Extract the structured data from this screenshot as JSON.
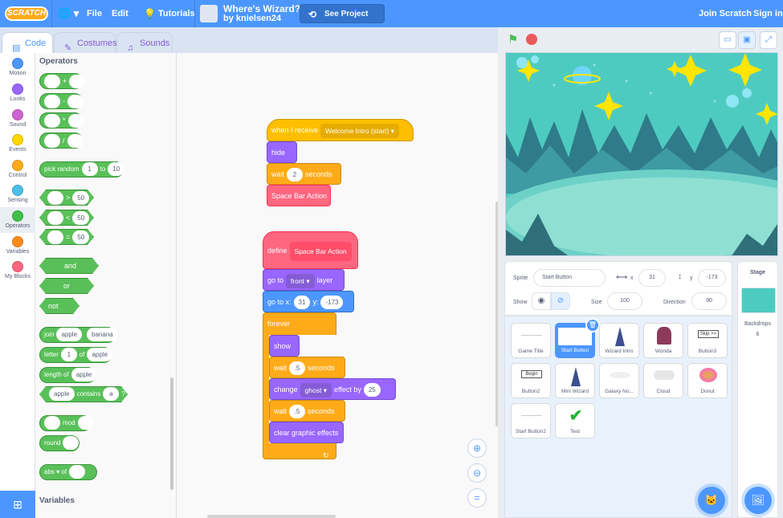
{
  "menu": {
    "logo": "SCRATCH",
    "file": "File",
    "edit": "Edit",
    "tutorials": "Tutorials",
    "project_title": "Where's Wizard?",
    "project_author": "by knielsen24",
    "see_project": "See Project Page",
    "join": "Join Scratch",
    "signin": "Sign in"
  },
  "tabs": {
    "code": "Code",
    "costumes": "Costumes",
    "sounds": "Sounds"
  },
  "categories": [
    {
      "label": "Motion",
      "color": "#4c97ff"
    },
    {
      "label": "Looks",
      "color": "#9966ff"
    },
    {
      "label": "Sound",
      "color": "#cf63cf"
    },
    {
      "label": "Events",
      "color": "#ffd500"
    },
    {
      "label": "Control",
      "color": "#ffab19"
    },
    {
      "label": "Sensing",
      "color": "#4cbfe6"
    },
    {
      "label": "Operators",
      "color": "#40bf4a"
    },
    {
      "label": "Variables",
      "color": "#ff8c1a"
    },
    {
      "label": "My Blocks",
      "color": "#ff6680"
    }
  ],
  "palette": {
    "heading": "Operators",
    "plus": "+",
    "minus": "-",
    "times": "*",
    "divide": "/",
    "pick_random": "pick random",
    "to": "to",
    "rand_from": "1",
    "rand_to": "10",
    "gt": ">",
    "lt": "<",
    "eq": "=",
    "fifty": "50",
    "and": "and",
    "or": "or",
    "not": "not",
    "join": "join",
    "apple": "apple",
    "banana": "banana",
    "letter": "letter",
    "of": "of",
    "one": "1",
    "length_of": "length of",
    "contains": "contains",
    "a": "a",
    "q": "?",
    "mod": "mod",
    "round": "round",
    "abs": "abs",
    "variables_heading": "Variables"
  },
  "scripts": {
    "when_receive": "when I receive",
    "message": "Welcome Intro (start)",
    "hide": "hide",
    "wait": "wait",
    "wait1_val": "2",
    "seconds": "seconds",
    "space_bar_action": "Space Bar Action",
    "define": "define",
    "go_to": "go to",
    "front": "front",
    "layer": "layer",
    "go_to_x": "go to x:",
    "x_val": "31",
    "y_lbl": "y:",
    "y_val": "-173",
    "forever": "forever",
    "show": "show",
    "wait_val": ".5",
    "change": "change",
    "effect": "ghost",
    "effect_by": "effect by",
    "effect_val": "25",
    "clear_effects": "clear graphic effects"
  },
  "sprite_info": {
    "sprite_lbl": "Sprite",
    "sprite_name": "Start Button",
    "x_lbl": "x",
    "x": "31",
    "y_lbl": "y",
    "y": "-173",
    "show_lbl": "Show",
    "size_lbl": "Size",
    "size": "100",
    "direction_lbl": "Direction",
    "direction": "90"
  },
  "sprites": [
    {
      "name": "Game Title"
    },
    {
      "name": "Start Button"
    },
    {
      "name": "Wizard Intro"
    },
    {
      "name": "Wonda"
    },
    {
      "name": "Button3"
    },
    {
      "name": "Button2"
    },
    {
      "name": "Mini Wizard"
    },
    {
      "name": "Galaxy No..."
    },
    {
      "name": "Cloud"
    },
    {
      "name": "Donut"
    },
    {
      "name": "Start Button2"
    },
    {
      "name": "Test"
    }
  ],
  "sprite_thumb_text": {
    "button3": "Skip >>",
    "button2": "Begin"
  },
  "stage_panel": {
    "label": "Stage",
    "backdrops": "Backdrops",
    "count": "6"
  }
}
